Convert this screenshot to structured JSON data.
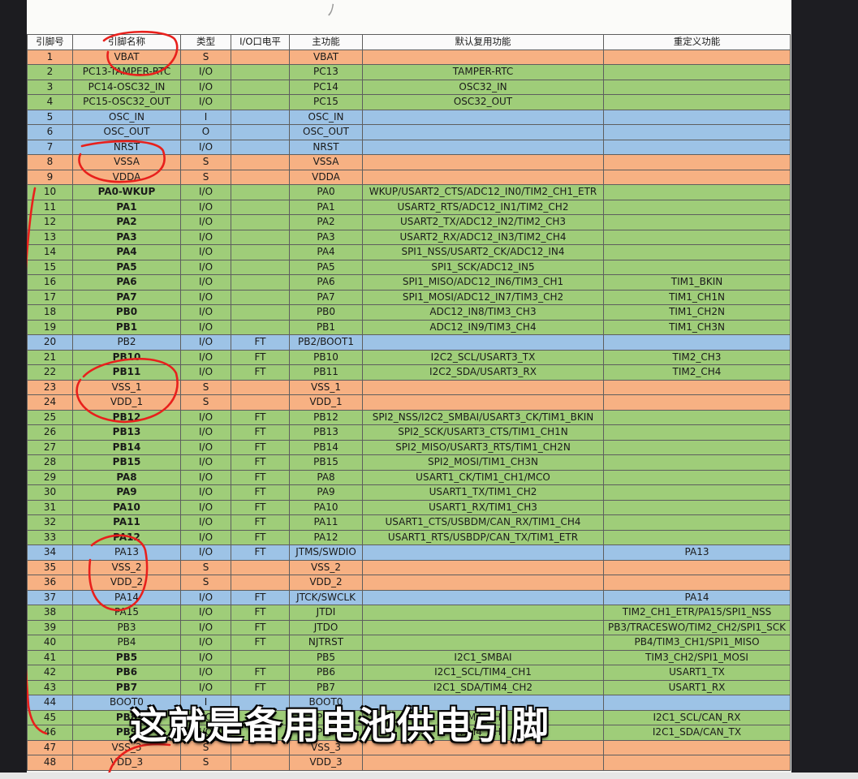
{
  "headers": [
    "引脚号",
    "引脚名称",
    "类型",
    "I/O口电平",
    "主功能",
    "默认复用功能",
    "重定义功能"
  ],
  "rows": [
    {
      "n": "1",
      "name": "VBAT",
      "type": "S",
      "lvl": "",
      "main": "VBAT",
      "def": "",
      "remap": "",
      "cls": "S",
      "bold": false
    },
    {
      "n": "2",
      "name": "PC13-TAMPER-RTC",
      "type": "I/O",
      "lvl": "",
      "main": "PC13",
      "def": "TAMPER-RTC",
      "remap": "",
      "cls": "IO",
      "bold": false
    },
    {
      "n": "3",
      "name": "PC14-OSC32_IN",
      "type": "I/O",
      "lvl": "",
      "main": "PC14",
      "def": "OSC32_IN",
      "remap": "",
      "cls": "IO",
      "bold": false
    },
    {
      "n": "4",
      "name": "PC15-OSC32_OUT",
      "type": "I/O",
      "lvl": "",
      "main": "PC15",
      "def": "OSC32_OUT",
      "remap": "",
      "cls": "IO",
      "bold": false
    },
    {
      "n": "5",
      "name": "OSC_IN",
      "type": "I",
      "lvl": "",
      "main": "OSC_IN",
      "def": "",
      "remap": "",
      "cls": "B",
      "bold": false
    },
    {
      "n": "6",
      "name": "OSC_OUT",
      "type": "O",
      "lvl": "",
      "main": "OSC_OUT",
      "def": "",
      "remap": "",
      "cls": "B",
      "bold": false
    },
    {
      "n": "7",
      "name": "NRST",
      "type": "I/O",
      "lvl": "",
      "main": "NRST",
      "def": "",
      "remap": "",
      "cls": "B",
      "bold": false
    },
    {
      "n": "8",
      "name": "VSSA",
      "type": "S",
      "lvl": "",
      "main": "VSSA",
      "def": "",
      "remap": "",
      "cls": "S",
      "bold": false
    },
    {
      "n": "9",
      "name": "VDDA",
      "type": "S",
      "lvl": "",
      "main": "VDDA",
      "def": "",
      "remap": "",
      "cls": "S",
      "bold": false
    },
    {
      "n": "10",
      "name": "PA0-WKUP",
      "type": "I/O",
      "lvl": "",
      "main": "PA0",
      "def": "WKUP/USART2_CTS/ADC12_IN0/TIM2_CH1_ETR",
      "remap": "",
      "cls": "IO",
      "bold": true
    },
    {
      "n": "11",
      "name": "PA1",
      "type": "I/O",
      "lvl": "",
      "main": "PA1",
      "def": "USART2_RTS/ADC12_IN1/TIM2_CH2",
      "remap": "",
      "cls": "IO",
      "bold": true
    },
    {
      "n": "12",
      "name": "PA2",
      "type": "I/O",
      "lvl": "",
      "main": "PA2",
      "def": "USART2_TX/ADC12_IN2/TIM2_CH3",
      "remap": "",
      "cls": "IO",
      "bold": true
    },
    {
      "n": "13",
      "name": "PA3",
      "type": "I/O",
      "lvl": "",
      "main": "PA3",
      "def": "USART2_RX/ADC12_IN3/TIM2_CH4",
      "remap": "",
      "cls": "IO",
      "bold": true
    },
    {
      "n": "14",
      "name": "PA4",
      "type": "I/O",
      "lvl": "",
      "main": "PA4",
      "def": "SPI1_NSS/USART2_CK/ADC12_IN4",
      "remap": "",
      "cls": "IO",
      "bold": true
    },
    {
      "n": "15",
      "name": "PA5",
      "type": "I/O",
      "lvl": "",
      "main": "PA5",
      "def": "SPI1_SCK/ADC12_IN5",
      "remap": "",
      "cls": "IO",
      "bold": true
    },
    {
      "n": "16",
      "name": "PA6",
      "type": "I/O",
      "lvl": "",
      "main": "PA6",
      "def": "SPI1_MISO/ADC12_IN6/TIM3_CH1",
      "remap": "TIM1_BKIN",
      "cls": "IO",
      "bold": true
    },
    {
      "n": "17",
      "name": "PA7",
      "type": "I/O",
      "lvl": "",
      "main": "PA7",
      "def": "SPI1_MOSI/ADC12_IN7/TIM3_CH2",
      "remap": "TIM1_CH1N",
      "cls": "IO",
      "bold": true
    },
    {
      "n": "18",
      "name": "PB0",
      "type": "I/O",
      "lvl": "",
      "main": "PB0",
      "def": "ADC12_IN8/TIM3_CH3",
      "remap": "TIM1_CH2N",
      "cls": "IO",
      "bold": true
    },
    {
      "n": "19",
      "name": "PB1",
      "type": "I/O",
      "lvl": "",
      "main": "PB1",
      "def": "ADC12_IN9/TIM3_CH4",
      "remap": "TIM1_CH3N",
      "cls": "IO",
      "bold": true
    },
    {
      "n": "20",
      "name": "PB2",
      "type": "I/O",
      "lvl": "FT",
      "main": "PB2/BOOT1",
      "def": "",
      "remap": "",
      "cls": "B",
      "bold": false
    },
    {
      "n": "21",
      "name": "PB10",
      "type": "I/O",
      "lvl": "FT",
      "main": "PB10",
      "def": "I2C2_SCL/USART3_TX",
      "remap": "TIM2_CH3",
      "cls": "IO",
      "bold": true
    },
    {
      "n": "22",
      "name": "PB11",
      "type": "I/O",
      "lvl": "FT",
      "main": "PB11",
      "def": "I2C2_SDA/USART3_RX",
      "remap": "TIM2_CH4",
      "cls": "IO",
      "bold": true
    },
    {
      "n": "23",
      "name": "VSS_1",
      "type": "S",
      "lvl": "",
      "main": "VSS_1",
      "def": "",
      "remap": "",
      "cls": "S",
      "bold": false
    },
    {
      "n": "24",
      "name": "VDD_1",
      "type": "S",
      "lvl": "",
      "main": "VDD_1",
      "def": "",
      "remap": "",
      "cls": "S",
      "bold": false
    },
    {
      "n": "25",
      "name": "PB12",
      "type": "I/O",
      "lvl": "FT",
      "main": "PB12",
      "def": "SPI2_NSS/I2C2_SMBAI/USART3_CK/TIM1_BKIN",
      "remap": "",
      "cls": "IO",
      "bold": true
    },
    {
      "n": "26",
      "name": "PB13",
      "type": "I/O",
      "lvl": "FT",
      "main": "PB13",
      "def": "SPI2_SCK/USART3_CTS/TIM1_CH1N",
      "remap": "",
      "cls": "IO",
      "bold": true
    },
    {
      "n": "27",
      "name": "PB14",
      "type": "I/O",
      "lvl": "FT",
      "main": "PB14",
      "def": "SPI2_MISO/USART3_RTS/TIM1_CH2N",
      "remap": "",
      "cls": "IO",
      "bold": true
    },
    {
      "n": "28",
      "name": "PB15",
      "type": "I/O",
      "lvl": "FT",
      "main": "PB15",
      "def": "SPI2_MOSI/TIM1_CH3N",
      "remap": "",
      "cls": "IO",
      "bold": true
    },
    {
      "n": "29",
      "name": "PA8",
      "type": "I/O",
      "lvl": "FT",
      "main": "PA8",
      "def": "USART1_CK/TIM1_CH1/MCO",
      "remap": "",
      "cls": "IO",
      "bold": true
    },
    {
      "n": "30",
      "name": "PA9",
      "type": "I/O",
      "lvl": "FT",
      "main": "PA9",
      "def": "USART1_TX/TIM1_CH2",
      "remap": "",
      "cls": "IO",
      "bold": true
    },
    {
      "n": "31",
      "name": "PA10",
      "type": "I/O",
      "lvl": "FT",
      "main": "PA10",
      "def": "USART1_RX/TIM1_CH3",
      "remap": "",
      "cls": "IO",
      "bold": true
    },
    {
      "n": "32",
      "name": "PA11",
      "type": "I/O",
      "lvl": "FT",
      "main": "PA11",
      "def": "USART1_CTS/USBDM/CAN_RX/TIM1_CH4",
      "remap": "",
      "cls": "IO",
      "bold": true
    },
    {
      "n": "33",
      "name": "PA12",
      "type": "I/O",
      "lvl": "FT",
      "main": "PA12",
      "def": "USART1_RTS/USBDP/CAN_TX/TIM1_ETR",
      "remap": "",
      "cls": "IO",
      "bold": true
    },
    {
      "n": "34",
      "name": "PA13",
      "type": "I/O",
      "lvl": "FT",
      "main": "JTMS/SWDIO",
      "def": "",
      "remap": "PA13",
      "cls": "B",
      "bold": false
    },
    {
      "n": "35",
      "name": "VSS_2",
      "type": "S",
      "lvl": "",
      "main": "VSS_2",
      "def": "",
      "remap": "",
      "cls": "S",
      "bold": false
    },
    {
      "n": "36",
      "name": "VDD_2",
      "type": "S",
      "lvl": "",
      "main": "VDD_2",
      "def": "",
      "remap": "",
      "cls": "S",
      "bold": false
    },
    {
      "n": "37",
      "name": "PA14",
      "type": "I/O",
      "lvl": "FT",
      "main": "JTCK/SWCLK",
      "def": "",
      "remap": "PA14",
      "cls": "B",
      "bold": false
    },
    {
      "n": "38",
      "name": "PA15",
      "type": "I/O",
      "lvl": "FT",
      "main": "JTDI",
      "def": "",
      "remap": "TIM2_CH1_ETR/PA15/SPI1_NSS",
      "cls": "IO",
      "bold": false
    },
    {
      "n": "39",
      "name": "PB3",
      "type": "I/O",
      "lvl": "FT",
      "main": "JTDO",
      "def": "",
      "remap": "PB3/TRACESWO/TIM2_CH2/SPI1_SCK",
      "cls": "IO",
      "bold": false
    },
    {
      "n": "40",
      "name": "PB4",
      "type": "I/O",
      "lvl": "FT",
      "main": "NJTRST",
      "def": "",
      "remap": "PB4/TIM3_CH1/SPI1_MISO",
      "cls": "IO",
      "bold": false
    },
    {
      "n": "41",
      "name": "PB5",
      "type": "I/O",
      "lvl": "",
      "main": "PB5",
      "def": "I2C1_SMBAI",
      "remap": "TIM3_CH2/SPI1_MOSI",
      "cls": "IO",
      "bold": true
    },
    {
      "n": "42",
      "name": "PB6",
      "type": "I/O",
      "lvl": "FT",
      "main": "PB6",
      "def": "I2C1_SCL/TIM4_CH1",
      "remap": "USART1_TX",
      "cls": "IO",
      "bold": true
    },
    {
      "n": "43",
      "name": "PB7",
      "type": "I/O",
      "lvl": "FT",
      "main": "PB7",
      "def": "I2C1_SDA/TIM4_CH2",
      "remap": "USART1_RX",
      "cls": "IO",
      "bold": true
    },
    {
      "n": "44",
      "name": "BOOT0",
      "type": "I",
      "lvl": "",
      "main": "BOOT0",
      "def": "",
      "remap": "",
      "cls": "B",
      "bold": false
    },
    {
      "n": "45",
      "name": "PB8",
      "type": "I/O",
      "lvl": "FT",
      "main": "PB8",
      "def": "TIM4_CH3",
      "remap": "I2C1_SCL/CAN_RX",
      "cls": "IO",
      "bold": true
    },
    {
      "n": "46",
      "name": "PB9",
      "type": "I/O",
      "lvl": "FT",
      "main": "PB9",
      "def": "TIM4_CH4",
      "remap": "I2C1_SDA/CAN_TX",
      "cls": "IO",
      "bold": true
    },
    {
      "n": "47",
      "name": "VSS_3",
      "type": "S",
      "lvl": "",
      "main": "VSS_3",
      "def": "",
      "remap": "",
      "cls": "S",
      "bold": false
    },
    {
      "n": "48",
      "name": "VDD_3",
      "type": "S",
      "lvl": "",
      "main": "VDD_3",
      "def": "",
      "remap": "",
      "cls": "S",
      "bold": false
    }
  ],
  "colors": {
    "S": "#f7b183",
    "IO": "#9fcd79",
    "B": "#9dc3e6",
    "annotation": "#e8201c"
  },
  "caption": "这就是备用电池供电引脚"
}
